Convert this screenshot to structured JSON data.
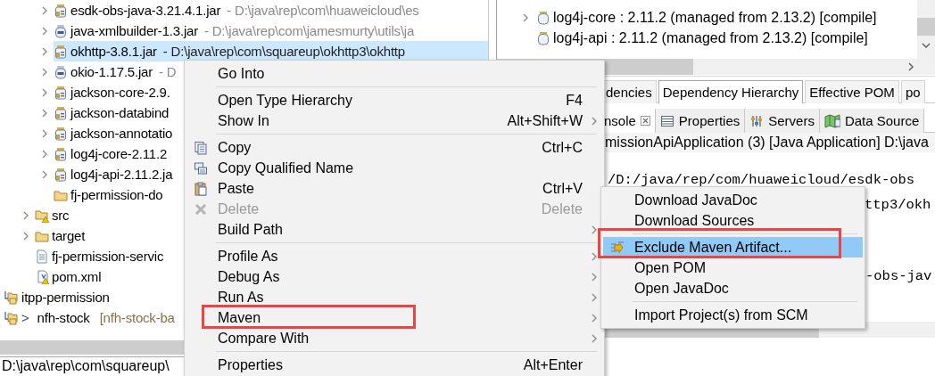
{
  "explorer": {
    "tree": [
      {
        "children": [
          {
            "children": [
              {
                "kind": "jar",
                "label": "esdk-obs-java-3.21.4.1.jar",
                "detail": "- D:\\java\\rep\\com\\huaweicloud\\es",
                "expandable": true,
                "selected": false
              },
              {
                "kind": "jar-plain",
                "label": "java-xmlbuilder-1.3.jar",
                "detail": "- D:\\java\\rep\\com\\jamesmurty\\utils\\ja",
                "expandable": true,
                "selected": false
              },
              {
                "kind": "jar",
                "label": "okhttp-3.8.1.jar",
                "detail": "- D:\\java\\rep\\com\\squareup\\okhttp3\\okhttp",
                "expandable": true,
                "selected": true
              },
              {
                "kind": "jar-plain",
                "label": "okio-1.17.5.jar",
                "detail": "- D",
                "expandable": true,
                "selected": false
              },
              {
                "kind": "jar",
                "label": "jackson-core-2.9.",
                "expandable": true,
                "selected": false
              },
              {
                "kind": "jar",
                "label": "jackson-databind",
                "expandable": true,
                "selected": false
              },
              {
                "kind": "jar",
                "label": "jackson-annotatio",
                "expandable": true,
                "selected": false
              },
              {
                "kind": "jar",
                "label": "log4j-core-2.11.2",
                "expandable": true,
                "selected": false
              },
              {
                "kind": "jar",
                "label": "log4j-api-2.11.2.ja",
                "expandable": true,
                "selected": false
              },
              {
                "kind": "folder",
                "label": "fj-permission-do",
                "expandable": false,
                "selected": false
              }
            ]
          },
          {
            "kind": "source-folder",
            "label": "src",
            "expandable": true,
            "selected": false
          },
          {
            "kind": "folder",
            "label": "target",
            "expandable": true,
            "selected": false
          },
          {
            "kind": "file",
            "label": "fj-permission-servic",
            "expandable": false,
            "selected": false
          },
          {
            "kind": "pom",
            "label": "pom.xml",
            "expandable": false,
            "selected": false
          }
        ]
      },
      {
        "kind": "project",
        "label": "itpp-permission",
        "selected": false
      },
      {
        "kind": "project",
        "prefix": ">",
        "label": "nfh-stock",
        "decoration": "[nfh-stock-ba",
        "selected": false
      }
    ],
    "status_text": "D:\\java\\rep\\com\\squareup\\"
  },
  "dependency_tree": {
    "items": [
      {
        "label": "log4j-core : 2.11.2 (managed from 2.13.2) [compile]",
        "expandable": true
      },
      {
        "label": "log4j-api : 2.11.2 (managed from 2.13.2) [compile]",
        "expandable": false
      }
    ]
  },
  "editor_tabs": [
    {
      "label": "dencies",
      "selected": false
    },
    {
      "label": "Dependency Hierarchy",
      "selected": true
    },
    {
      "label": "Effective POM",
      "selected": false
    },
    {
      "label": "po",
      "selected": false
    }
  ],
  "view_tabs": [
    {
      "kind": "console",
      "label": "nsole",
      "selected": true
    },
    {
      "kind": "properties",
      "label": "Properties",
      "selected": false
    },
    {
      "kind": "servers",
      "label": "Servers",
      "selected": false
    },
    {
      "kind": "data-source",
      "label": "Data Source",
      "selected": false
    }
  ],
  "console": {
    "header": "missionApiApplication (3) [Java Application] D:\\java",
    "lines": [
      "/D:/java/rep/com/huaweicloud/esdk-obs",
      "ttp3/okh",
      "-obs-jav"
    ]
  },
  "context_menu": {
    "items": [
      {
        "kind": "item",
        "label": "Go Into",
        "submenu": false,
        "disabled": false
      },
      {
        "kind": "separator"
      },
      {
        "kind": "item",
        "label": "Open Type Hierarchy",
        "shortcut": "F4",
        "submenu": false,
        "disabled": false
      },
      {
        "kind": "item",
        "label": "Show In",
        "shortcut": "Alt+Shift+W",
        "submenu": true,
        "disabled": false
      },
      {
        "kind": "separator"
      },
      {
        "kind": "item",
        "label": "Copy",
        "shortcut": "Ctrl+C",
        "submenu": false,
        "disabled": false
      },
      {
        "kind": "item",
        "label": "Copy Qualified Name",
        "submenu": false,
        "disabled": false
      },
      {
        "kind": "item",
        "label": "Paste",
        "shortcut": "Ctrl+V",
        "submenu": false,
        "disabled": false
      },
      {
        "kind": "item",
        "label": "Delete",
        "shortcut": "Delete",
        "submenu": false,
        "disabled": true
      },
      {
        "kind": "item",
        "label": "Build Path",
        "submenu": true,
        "disabled": false
      },
      {
        "kind": "separator"
      },
      {
        "kind": "item",
        "label": "Profile As",
        "submenu": true,
        "disabled": false
      },
      {
        "kind": "item",
        "label": "Debug As",
        "submenu": true,
        "disabled": false
      },
      {
        "kind": "item",
        "label": "Run As",
        "submenu": true,
        "disabled": false
      },
      {
        "kind": "item",
        "label": "Maven",
        "submenu": true,
        "disabled": false
      },
      {
        "kind": "item",
        "label": "Compare With",
        "submenu": true,
        "disabled": false
      },
      {
        "kind": "separator"
      },
      {
        "kind": "item",
        "label": "Properties",
        "shortcut": "Alt+Enter",
        "submenu": false,
        "disabled": false
      }
    ]
  },
  "submenu": {
    "items": [
      {
        "kind": "item",
        "label": "Download JavaDoc",
        "selected": false
      },
      {
        "kind": "item",
        "label": "Download Sources",
        "selected": false
      },
      {
        "kind": "separator"
      },
      {
        "kind": "item",
        "label": "Exclude Maven Artifact...",
        "selected": true
      },
      {
        "kind": "item",
        "label": "Open POM",
        "selected": false
      },
      {
        "kind": "item",
        "label": "Open JavaDoc",
        "selected": false
      },
      {
        "kind": "separator"
      },
      {
        "kind": "item",
        "label": "Import Project(s) from SCM",
        "selected": false
      }
    ]
  }
}
